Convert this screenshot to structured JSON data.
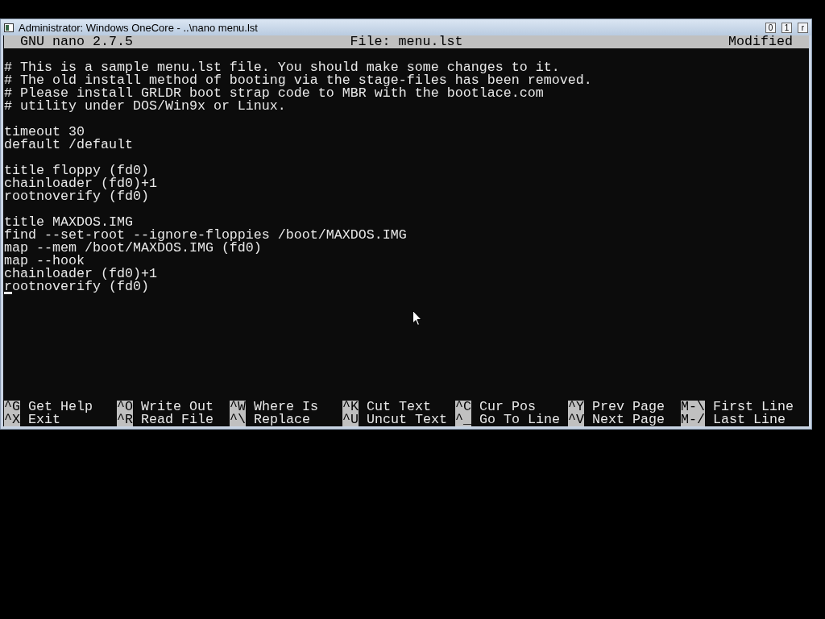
{
  "window": {
    "title": "Administrator:  Windows OneCore - ..\\nano  menu.lst",
    "controls": [
      "0",
      "1",
      "r"
    ]
  },
  "header": {
    "version": "GNU nano 2.7.5",
    "file": "File: menu.lst",
    "status": "Modified"
  },
  "blocks": [
    [
      {
        "text": "# This is a sample menu.lst file. You should make some changes to it.",
        "cursor": false
      },
      {
        "text": "# The old install method of booting via the stage-files has been removed.",
        "cursor": false
      },
      {
        "text": "# Please install GRLDR boot strap code to MBR with the bootlace.com",
        "cursor": false
      },
      {
        "text": "# utility under DOS/Win9x or Linux.",
        "cursor": false
      }
    ],
    [
      {
        "text": "timeout 30",
        "cursor": false
      },
      {
        "text": "default /default",
        "cursor": false
      }
    ],
    [
      {
        "text": "title floppy (fd0)",
        "cursor": false
      },
      {
        "text": "chainloader (fd0)+1",
        "cursor": false
      },
      {
        "text": "rootnoverify (fd0)",
        "cursor": false
      }
    ],
    [
      {
        "text": "title MAXDOS.IMG",
        "cursor": false
      },
      {
        "text": "find --set-root --ignore-floppies /boot/MAXDOS.IMG",
        "cursor": false
      },
      {
        "text": "map --mem /boot/MAXDOS.IMG (fd0)",
        "cursor": false
      },
      {
        "text": "map --hook",
        "cursor": false
      },
      {
        "text": "chainloader (fd0)+1",
        "cursor": false
      },
      {
        "text": "rootnoverify (fd0)",
        "cursor": true
      }
    ]
  ],
  "shortcuts": [
    [
      {
        "key": "^G",
        "label": "Get Help"
      },
      {
        "key": "^X",
        "label": "Exit"
      }
    ],
    [
      {
        "key": "^O",
        "label": "Write Out"
      },
      {
        "key": "^R",
        "label": "Read File"
      }
    ],
    [
      {
        "key": "^W",
        "label": "Where Is"
      },
      {
        "key": "^\\",
        "label": "Replace"
      }
    ],
    [
      {
        "key": "^K",
        "label": "Cut Text"
      },
      {
        "key": "^U",
        "label": "Uncut Text"
      }
    ],
    [
      {
        "key": "^C",
        "label": "Cur Pos"
      },
      {
        "key": "^_",
        "label": "Go To Line"
      }
    ],
    [
      {
        "key": "^Y",
        "label": "Prev Page"
      },
      {
        "key": "^V",
        "label": "Next Page"
      }
    ],
    [
      {
        "key": "M-\\",
        "label": "First Line"
      },
      {
        "key": "M-/",
        "label": "Last Line"
      }
    ]
  ]
}
